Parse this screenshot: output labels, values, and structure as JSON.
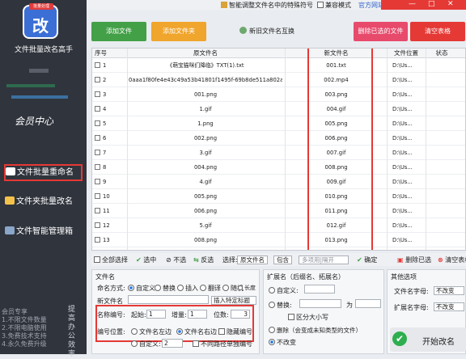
{
  "app": {
    "title": "文件批量改名高手",
    "logo_glyph": "改",
    "logo_tag": "批量处理",
    "member": "会员中心"
  },
  "sidebar": {
    "items": [
      {
        "label": "文件批量重命名"
      },
      {
        "label": "文件夹批量改名"
      },
      {
        "label": "文件智能管理箱"
      }
    ],
    "footer": "会员专享\n1.不限文件数量\n2.不限电脑使用\n3.免费技术支持\n4.永久免费升级",
    "side_text": "提高办公效率"
  },
  "topbar": {
    "special_chars": "智能调整文件名中的特殊符号",
    "compat": "兼容模式",
    "site": "官方网站",
    "controls": [
      "—",
      "□",
      "✕"
    ]
  },
  "toolbar": {
    "add_file": "添加文件",
    "add_folder": "添加文件夹",
    "swap": "新旧文件名互换",
    "delete_selected": "删除已选的文件",
    "clear": "清空表格"
  },
  "table": {
    "headers": {
      "index": "序号",
      "original": "原文件名",
      "new": "新文件名",
      "location": "文件位置",
      "status": "状态"
    },
    "rows": [
      {
        "index": "1",
        "original": "《萌宝猫咪们降临》TXT(1).txt",
        "new": "001.txt",
        "location": "D:\\Us..."
      },
      {
        "index": "2",
        "original": "0aaa1f80fe4e43c49a53b41801f1495f-69b8de511a802aa...",
        "new": "002.mp4",
        "location": "D:\\Us..."
      },
      {
        "index": "3",
        "original": "001.png",
        "new": "003.png",
        "location": "D:\\Us..."
      },
      {
        "index": "4",
        "original": "1.gif",
        "new": "004.gif",
        "location": "D:\\Us..."
      },
      {
        "index": "5",
        "original": "1.png",
        "new": "005.png",
        "location": "D:\\Us..."
      },
      {
        "index": "6",
        "original": "002.png",
        "new": "006.png",
        "location": "D:\\Us..."
      },
      {
        "index": "7",
        "original": "3.gif",
        "new": "007.gif",
        "location": "D:\\Us..."
      },
      {
        "index": "8",
        "original": "004.png",
        "new": "008.png",
        "location": "D:\\Us..."
      },
      {
        "index": "9",
        "original": "4.gif",
        "new": "009.gif",
        "location": "D:\\Us..."
      },
      {
        "index": "10",
        "original": "005.png",
        "new": "010.png",
        "location": "D:\\Us..."
      },
      {
        "index": "11",
        "original": "006.png",
        "new": "011.png",
        "location": "D:\\Us..."
      },
      {
        "index": "12",
        "original": "5.gif",
        "new": "012.gif",
        "location": "D:\\Us..."
      },
      {
        "index": "13",
        "original": "008.png",
        "new": "013.png",
        "location": "D:\\Us..."
      }
    ]
  },
  "selbar": {
    "select_all": "全部选择",
    "select": "选中",
    "unselect": "不选",
    "invert": "反选",
    "choose": "选择:",
    "field": "原文件名",
    "mode": "包含",
    "pattern_placeholder": "多项用|隔开",
    "confirm": "确定",
    "delete_checked": "删除已选",
    "clear_table": "清空表格"
  },
  "name_panel": {
    "title": "文件名",
    "mode_label": "命名方式:",
    "modes": [
      "自定义",
      "替换",
      "插入",
      "翻译",
      "随机",
      "长度"
    ],
    "new_name_label": "新文件名",
    "insert_special": "插入特定标题",
    "numbering_label": "名称编号:",
    "start_label": "起始:",
    "start_value": "1",
    "step_label": "增量:",
    "step_value": "1",
    "digits_label": "位数:",
    "digits_value": "3",
    "position_label": "编号位置:",
    "positions": [
      "文件名左边",
      "文件名右边",
      "隐藏编号"
    ],
    "custom_label": "自定义:",
    "custom_value": "2",
    "diff_path": "不同路径单独编号"
  },
  "ext_panel": {
    "title": "扩展名（后缀名、拓展名）",
    "custom": "自定义:",
    "replace": "替换:",
    "to": "为",
    "case_sensitive": "区分大小写",
    "delete_note": "删除（会变成未知类型的文件）",
    "unchanged": "不改变"
  },
  "other_panel": {
    "title": "其他选项",
    "name_case_label": "文件名字母:",
    "name_case_value": "不改变",
    "ext_case_label": "扩展名字母:",
    "ext_case_value": "不改变"
  },
  "start": {
    "label": "开始改名",
    "icon": "check-icon"
  }
}
